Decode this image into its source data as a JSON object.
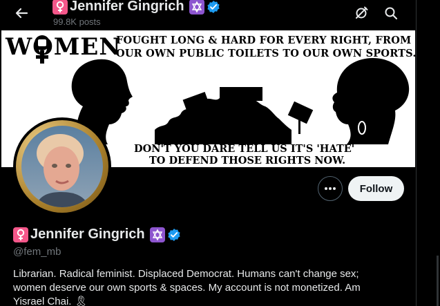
{
  "header": {
    "title": "Jennifer Gingrich",
    "post_count": "99.8K posts"
  },
  "banner": {
    "headline_word": "WOMEN",
    "headline_line1": "FOUGHT LONG & HARD FOR EVERY RIGHT, FROM",
    "headline_line2": "OUR OWN PUBLIC TOILETS TO OUR OWN SPORTS.",
    "footer_line1": "DON'T YOU DARE TELL US IT'S 'HATE'",
    "footer_line2": "TO DEFEND THOSE RIGHTS NOW."
  },
  "actions": {
    "follow_label": "Follow"
  },
  "profile": {
    "display_name": "Jennifer Gingrich",
    "handle": "@fem_mb",
    "bio": "Librarian. Radical feminist. Displaced Democrat. Humans can't change sex; women deserve our own sports & spaces. My account is not monetized. Am Yisrael Chai. 🎗"
  },
  "icons": {
    "back": "arrow-left-icon",
    "notifications_off": "bell-off-icon",
    "search": "search-icon",
    "more": "more-dots-icon",
    "venus": "venus-symbol-icon",
    "star_of_david": "star-of-david-icon",
    "verified": "verified-badge-icon"
  },
  "colors": {
    "background": "#000000",
    "text": "#e7e9ea",
    "muted": "#71767b",
    "venus_badge": "#f4578a",
    "star_badge": "#8d55cf",
    "verified": "#1d9bf0",
    "follow_bg": "#eff3f4"
  }
}
